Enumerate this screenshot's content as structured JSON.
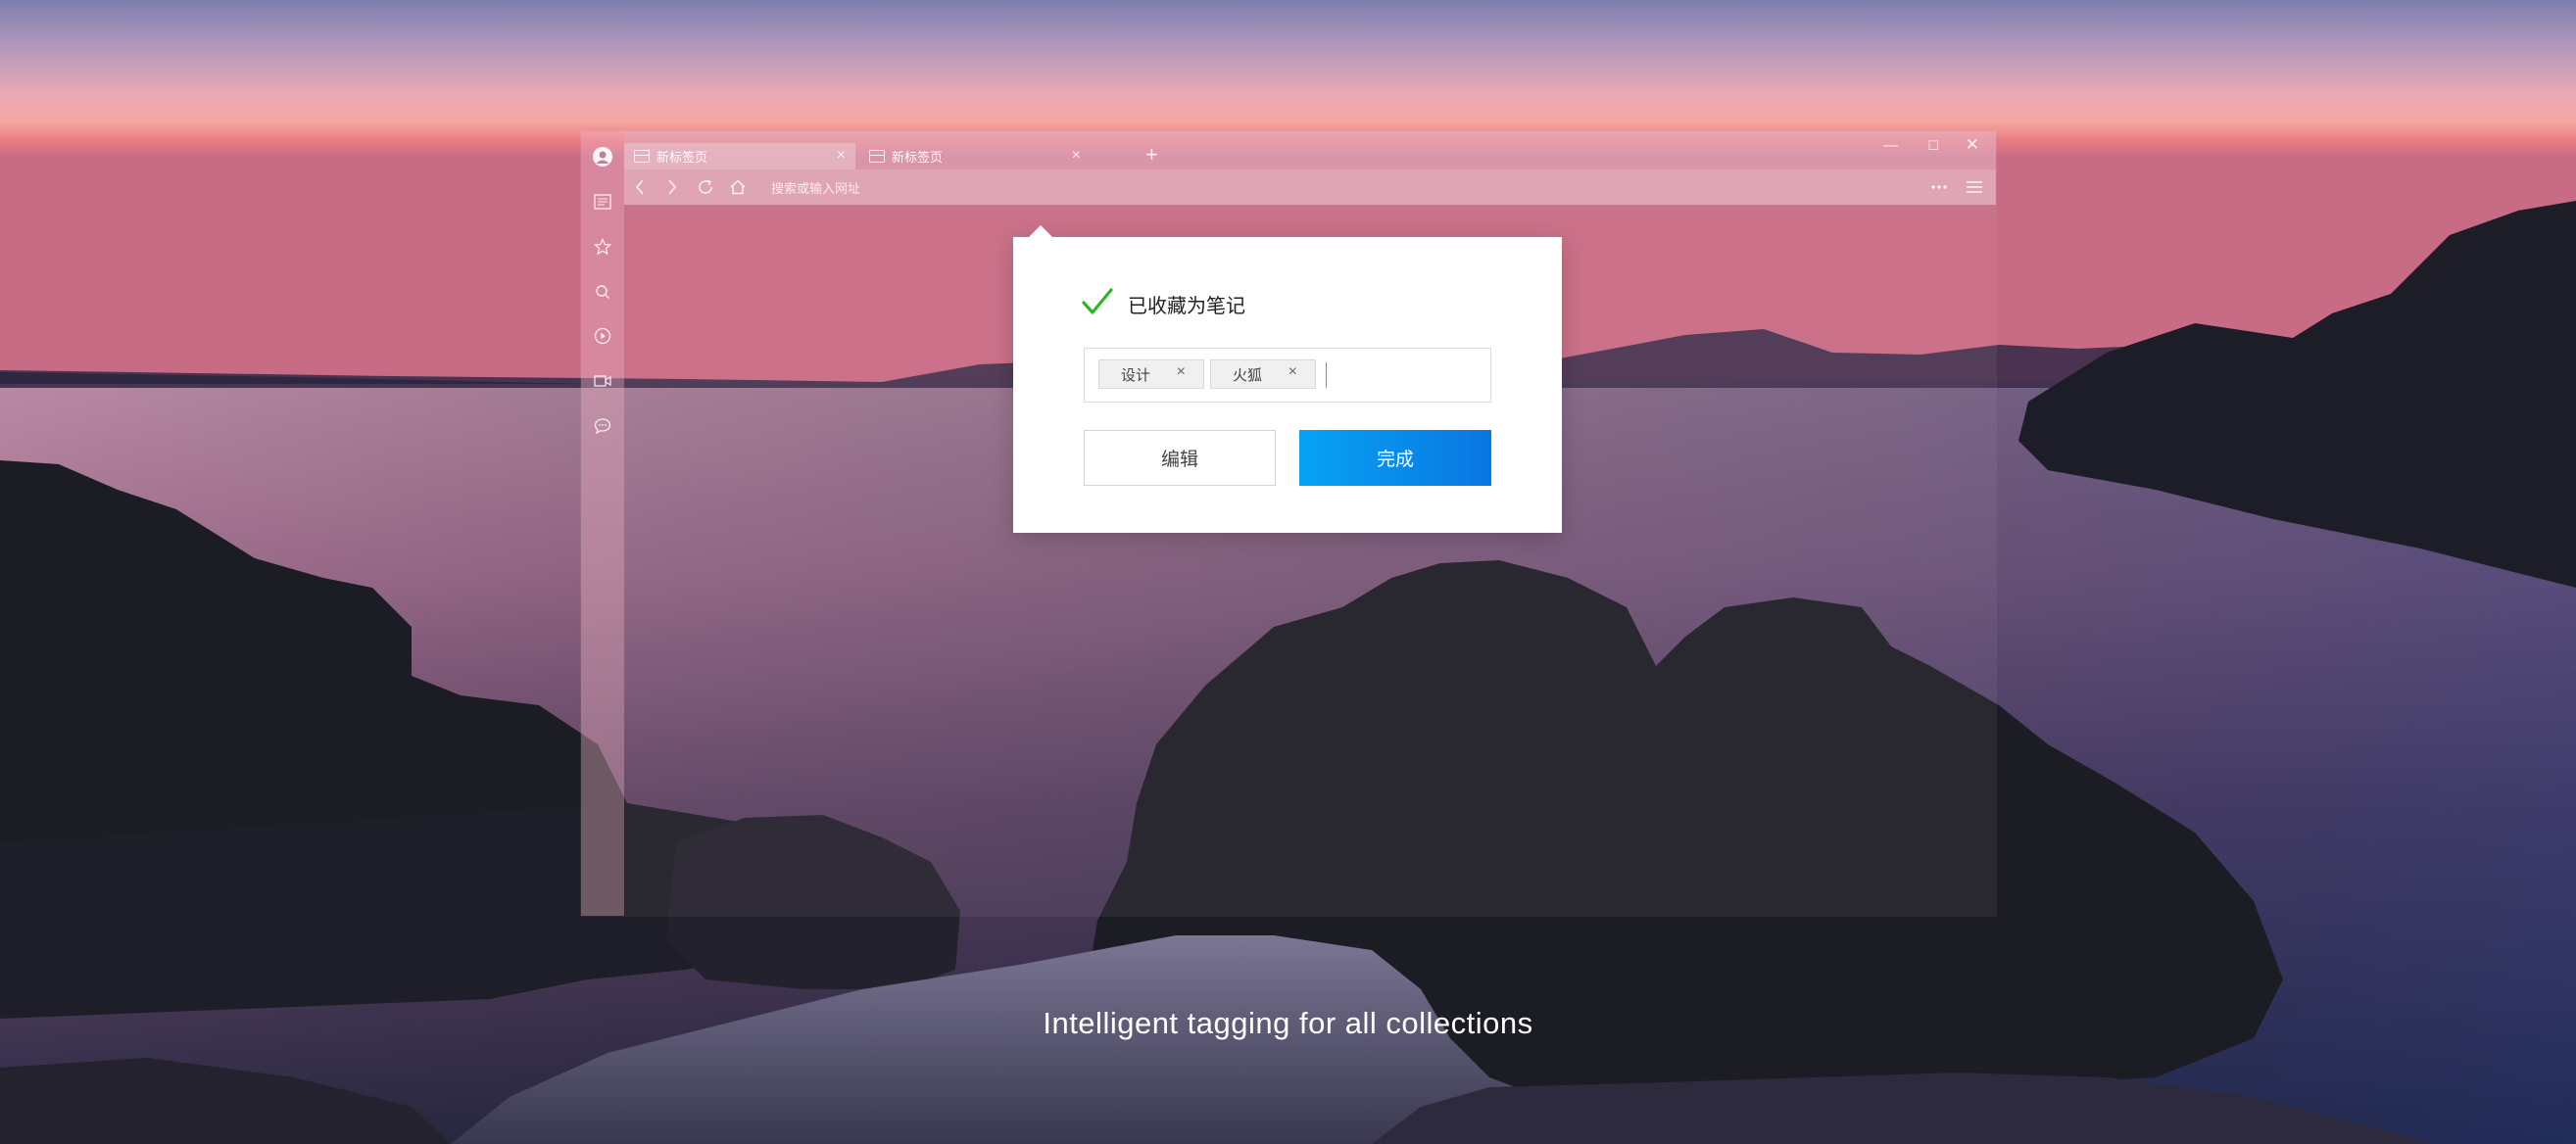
{
  "browser": {
    "tabs": [
      {
        "label": "新标签页"
      },
      {
        "label": "新标签页"
      }
    ],
    "address_placeholder": "搜索或输入网址"
  },
  "dialog": {
    "title": "已收藏为笔记",
    "tags": [
      {
        "label": "设计"
      },
      {
        "label": "火狐"
      }
    ],
    "edit_label": "编辑",
    "done_label": "完成"
  },
  "caption": "Intelligent tagging for all collections",
  "colors": {
    "accent": "#0a8cf0",
    "check": "#2ab52a"
  },
  "icons": {
    "sidebar": [
      "avatar-icon",
      "notes-icon",
      "star-icon",
      "search-icon",
      "play-icon",
      "video-icon",
      "chat-icon"
    ],
    "nav": [
      "back-icon",
      "forward-icon",
      "reload-icon",
      "home-icon",
      "more-icon",
      "menu-icon"
    ]
  }
}
